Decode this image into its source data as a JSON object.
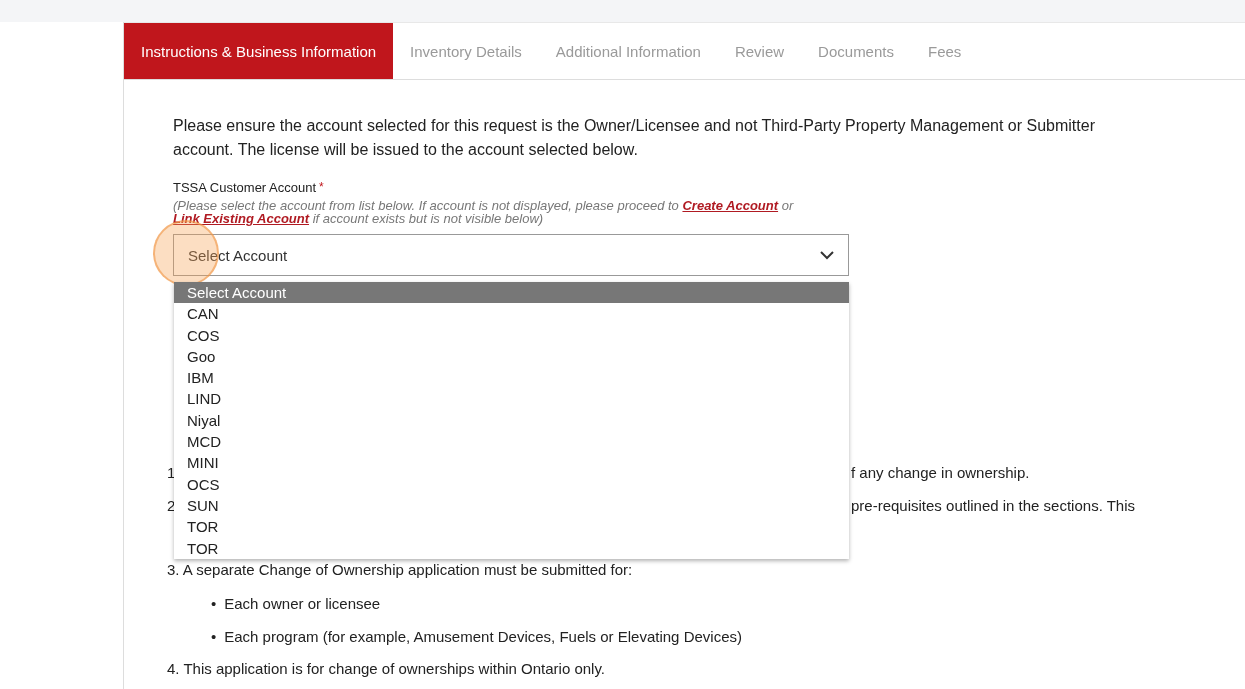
{
  "tabs": [
    {
      "label": "Instructions & Business Information",
      "selected": true
    },
    {
      "label": "Inventory Details",
      "selected": false
    },
    {
      "label": "Additional Information",
      "selected": false
    },
    {
      "label": "Review",
      "selected": false
    },
    {
      "label": "Documents",
      "selected": false
    },
    {
      "label": "Fees",
      "selected": false
    }
  ],
  "intro": "Please ensure the account selected for this request is the Owner/Licensee and not Third-Party Property Management or Submitter account. The license will be issued to the account selected below.",
  "account_field": {
    "label": "TSSA Customer Account",
    "required_mark": "*",
    "hint_parts": [
      {
        "kind": "text",
        "text": "(Please select the account from list below. If account is not displayed, please proceed to "
      },
      {
        "kind": "link",
        "text": "Create Account"
      },
      {
        "kind": "text",
        "text": " or "
      },
      {
        "kind": "link",
        "text": "Link Existing Account"
      },
      {
        "kind": "text",
        "text": " if account exists but is not visible below)"
      }
    ],
    "value": "Select Account",
    "expanded": true,
    "options": [
      {
        "label": "Select Account",
        "selected": true
      },
      {
        "label": "CAN",
        "selected": false
      },
      {
        "label": "COS",
        "selected": false
      },
      {
        "label": "Goo",
        "selected": false
      },
      {
        "label": "IBM",
        "selected": false
      },
      {
        "label": "LIND",
        "selected": false
      },
      {
        "label": "Niyal",
        "selected": false
      },
      {
        "label": "MCD",
        "selected": false
      },
      {
        "label": "MINI",
        "selected": false
      },
      {
        "label": "OCS",
        "selected": false
      },
      {
        "label": "SUN",
        "selected": false
      },
      {
        "label": "TOR",
        "selected": false
      },
      {
        "label": "TOR",
        "selected": false
      }
    ]
  },
  "instructions": [
    {
      "kind": "covered",
      "number": "1",
      "text_end": "f any change in ownership."
    },
    {
      "kind": "covered",
      "number": "2",
      "text_end": "pre-requisites outlined in the sections. This"
    },
    {
      "kind": "full",
      "text": "3. A separate Change of Ownership application must be submitted for:",
      "bullets": [
        {
          "marker": "•",
          "text": "Each owner or licensee"
        },
        {
          "marker": "•",
          "text": "Each program (for example, Amusement Devices, Fuels or Elevating Devices)"
        }
      ]
    },
    {
      "kind": "full",
      "text": "4. This application is for change of ownerships within Ontario only."
    }
  ]
}
